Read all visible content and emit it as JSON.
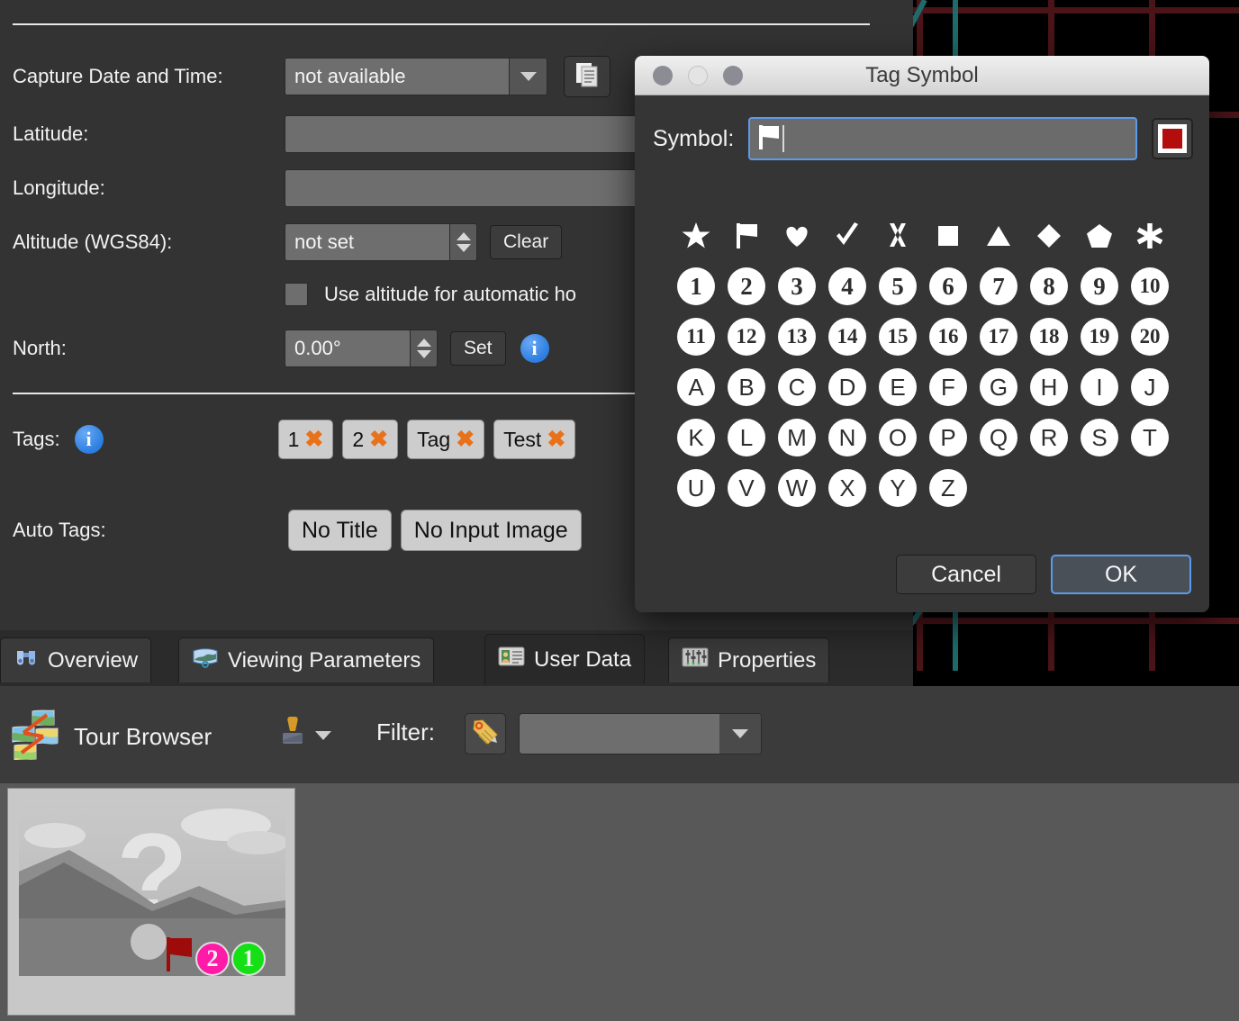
{
  "panel": {
    "fields": [
      {
        "label": "Capture Date and Time:",
        "value": "not available",
        "control": "combobox",
        "icon": "copy-icon"
      },
      {
        "label": "Latitude:",
        "value": "",
        "control": "text"
      },
      {
        "label": "Longitude:",
        "value": "",
        "control": "text"
      },
      {
        "label": "Altitude (WGS84):",
        "value": "not set",
        "control": "spinbox",
        "button": "Clear"
      }
    ],
    "checkbox": {
      "label": "Use altitude for automatic ho",
      "checked": false
    },
    "north": {
      "label": "North:",
      "value": "0.00°",
      "button": "Set",
      "info": "i"
    },
    "tags": {
      "label": "Tags:",
      "info": "i",
      "items": [
        {
          "text": "1",
          "remove": "✖"
        },
        {
          "text": "2",
          "remove": "✖"
        },
        {
          "text": "Tag",
          "remove": "✖"
        },
        {
          "text": "Test",
          "remove": "✖"
        }
      ]
    },
    "auto_tags": {
      "label": "Auto Tags:",
      "items": [
        "No Title",
        "No Input Image"
      ]
    }
  },
  "tabs": [
    {
      "label": "Overview",
      "icon": "binoculars-icon",
      "active": false
    },
    {
      "label": "Viewing Parameters",
      "icon": "panorama-icon",
      "active": false
    },
    {
      "label": "User Data",
      "icon": "id-card-icon",
      "active": true
    },
    {
      "label": "Properties",
      "icon": "sliders-icon",
      "active": false
    }
  ],
  "tour_browser": {
    "title": "Tour Browser",
    "title_icon": "tour-browser-icon",
    "stamp_icon": "stamp-icon",
    "filter_label": "Filter:",
    "filter_icon": "tag-icon",
    "filter_value": "",
    "filter_placeholder": ""
  },
  "thumbnail": {
    "name": "placeholder-image-thumbnail",
    "watermark": "?",
    "badges": [
      {
        "type": "flag",
        "color": "#9e0b0b",
        "label": ""
      },
      {
        "type": "circle",
        "color": "#ff1aa8",
        "label": "2"
      },
      {
        "type": "circle",
        "color": "#15e015",
        "label": "1"
      }
    ]
  },
  "dialog": {
    "title": "Tag Symbol",
    "traffic_lights": [
      "close",
      "minimize",
      "zoom"
    ],
    "symbol_label": "Symbol:",
    "symbol_value": "⚑",
    "color": "#b30d0d",
    "shapes": [
      {
        "name": "star-symbol",
        "glyph": "star"
      },
      {
        "name": "flag-symbol",
        "glyph": "flag"
      },
      {
        "name": "heart-symbol",
        "glyph": "heart"
      },
      {
        "name": "check-symbol",
        "glyph": "check"
      },
      {
        "name": "cross-symbol",
        "glyph": "cross"
      },
      {
        "name": "square-symbol",
        "glyph": "square"
      },
      {
        "name": "triangle-symbol",
        "glyph": "triangle"
      },
      {
        "name": "diamond-symbol",
        "glyph": "diamond"
      },
      {
        "name": "pentagon-symbol",
        "glyph": "pentagon"
      },
      {
        "name": "asterisk-symbol",
        "glyph": "asterisk"
      }
    ],
    "numbers": [
      "1",
      "2",
      "3",
      "4",
      "5",
      "6",
      "7",
      "8",
      "9",
      "10",
      "11",
      "12",
      "13",
      "14",
      "15",
      "16",
      "17",
      "18",
      "19",
      "20"
    ],
    "letters": [
      "A",
      "B",
      "C",
      "D",
      "E",
      "F",
      "G",
      "H",
      "I",
      "J",
      "K",
      "L",
      "M",
      "N",
      "O",
      "P",
      "Q",
      "R",
      "S",
      "T",
      "U",
      "V",
      "W",
      "X",
      "Y",
      "Z"
    ],
    "cancel_label": "Cancel",
    "ok_label": "OK"
  },
  "colors": {
    "panel_bg": "#333333",
    "dialog_bg": "#353535",
    "accent_blue": "#5b9bec",
    "tag_orange": "#e8711a",
    "swatch_red": "#b30d0d",
    "grid_red": "#4a1418",
    "teal": "#1d6b6b"
  }
}
